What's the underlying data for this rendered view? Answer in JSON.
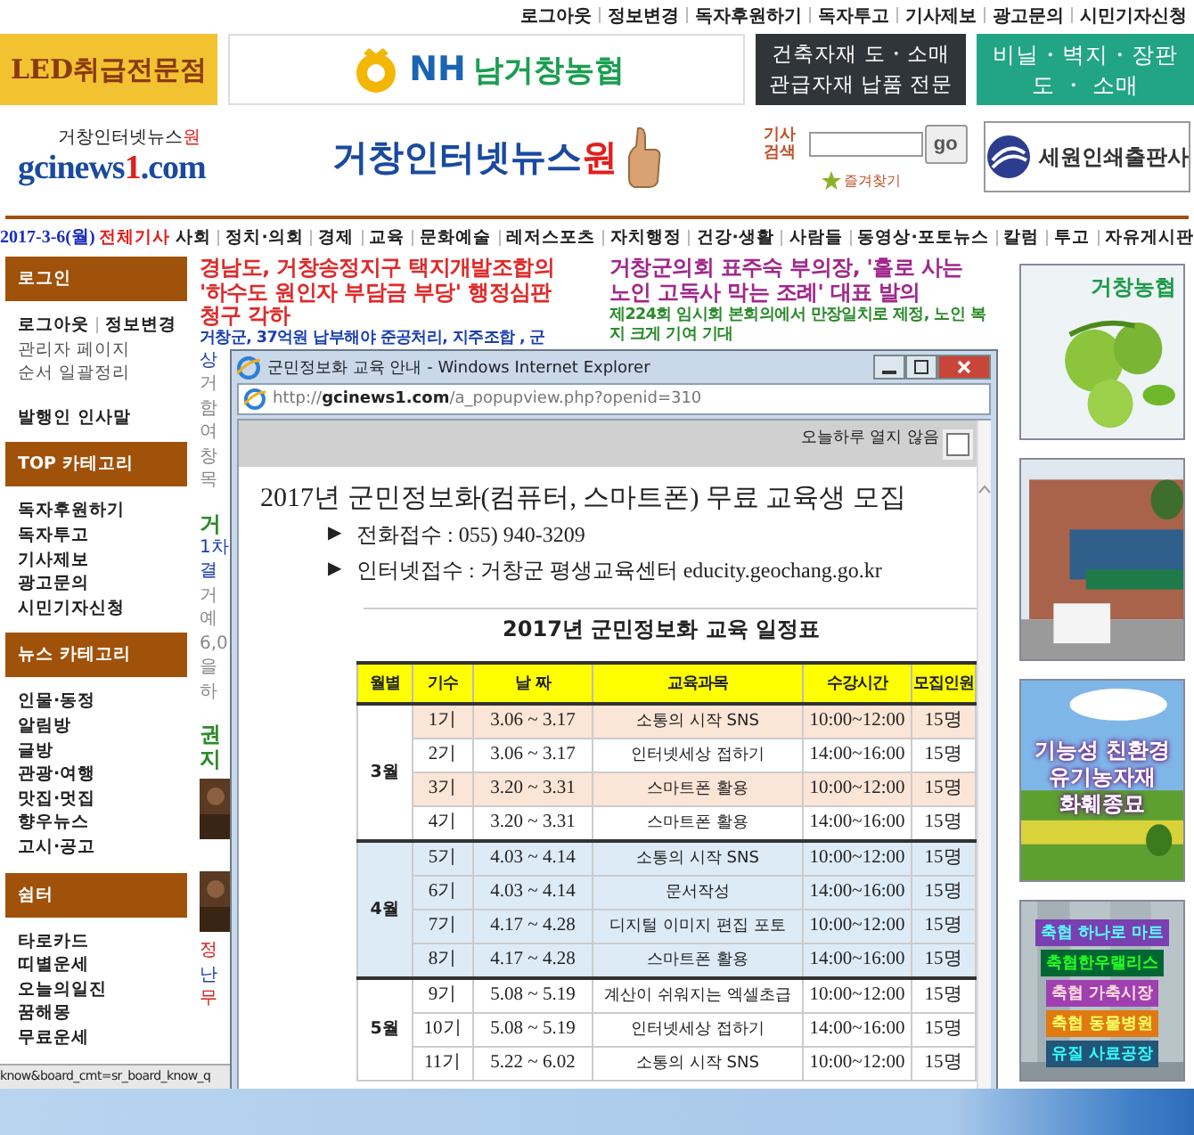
{
  "top_links": [
    "로그아웃",
    "정보변경",
    "독자후원하기",
    "독자투고",
    "기사제보",
    "광고문의",
    "시민기자신청"
  ],
  "header_ads": {
    "led": "LED취급전문점",
    "nh_prefix": "NH",
    "nh_name": "남거창농협",
    "building": [
      "건축자재 도・소매",
      "관급자재 납품 전문"
    ],
    "vinyl": [
      "비닐・벽지・장판",
      "도 ・ 소매"
    ]
  },
  "logo": {
    "sub": "거창인터넷뉴스",
    "sub_accent": "원",
    "main": "gcinews",
    "main_accent": "1",
    "main_end": ".com"
  },
  "site_title": {
    "text": "거창인터넷뉴스",
    "accent": "원"
  },
  "search": {
    "label": "기사 검색",
    "button": "go",
    "bookmark": "즐겨찾기"
  },
  "print_ad": "세원인쇄출판사",
  "nav": {
    "date": "2017-3-6(월)",
    "all": "전체기사",
    "items": [
      "사회",
      "정치·의회",
      "경제",
      "교육",
      "문화예술",
      "레저스포츠",
      "자치행정",
      "건강·생활",
      "사람들",
      "동영상·포토뉴스",
      "칼럼",
      "투고",
      "자유게시판"
    ]
  },
  "sidebar": [
    {
      "title": "로그인",
      "links": [
        "로그아웃",
        "정보변경"
      ],
      "items": [
        "관리자 페이지",
        "순서 일괄정리"
      ],
      "extra": "발행인 인사말"
    },
    {
      "title": "TOP 카테고리",
      "items": [
        "독자후원하기",
        "독자투고",
        "기사제보",
        "광고문의",
        "시민기자신청"
      ]
    },
    {
      "title": "뉴스 카테고리",
      "items": [
        "인물·동정",
        "알림방",
        "글방",
        "관광·여행",
        "맛집·멋집",
        "향우뉴스",
        "고시·공고"
      ]
    },
    {
      "title": "쉼터",
      "items": [
        "타로카드",
        "띠별운세",
        "오늘의일진",
        "꿈해몽",
        "무료운세"
      ]
    }
  ],
  "news": [
    {
      "headline": "경남도, 거창송정지구 택지개발조합의 '하수도 원인자 부담금 부당' 행정심판 청구 각하",
      "subtitle": "거창군, 37억원 납부해야 준공처리, 지주조합 , 군"
    },
    {
      "headline": "거창군의회 표주숙 부의장, '홀로 사는 노인 고독사 막는 조례' 대표 발의",
      "subtitle": "제224회 임시회 본회의에서 만장일치로 제정, 노인 복지 크게 기여 기대"
    }
  ],
  "fragments": [
    {
      "kind": "sub",
      "text": "상"
    },
    {
      "kind": "body",
      "text": "거"
    },
    {
      "kind": "body",
      "text": "함"
    },
    {
      "kind": "body",
      "text": "여"
    },
    {
      "kind": "body",
      "text": "창"
    },
    {
      "kind": "body",
      "text": "목"
    },
    {
      "kind": "gap"
    },
    {
      "kind": "green",
      "text": "거"
    },
    {
      "kind": "sub",
      "text": "1차"
    },
    {
      "kind": "sub",
      "text": "결"
    },
    {
      "kind": "body",
      "text": "거"
    },
    {
      "kind": "body",
      "text": "예"
    },
    {
      "kind": "body",
      "text": "6,0"
    },
    {
      "kind": "body",
      "text": "을"
    },
    {
      "kind": "body",
      "text": "하"
    },
    {
      "kind": "gap"
    },
    {
      "kind": "green",
      "text": "권"
    },
    {
      "kind": "green",
      "text": "지"
    },
    {
      "kind": "picture"
    },
    {
      "kind": "gap"
    },
    {
      "kind": "picture"
    },
    {
      "kind": "red",
      "text": "정"
    },
    {
      "kind": "sub",
      "text": "난"
    },
    {
      "kind": "red",
      "text": "무"
    }
  ],
  "right_ads": [
    {
      "kind": "orchard",
      "text": [
        "거창농협"
      ]
    },
    {
      "kind": "building"
    },
    {
      "kind": "field",
      "text": [
        "기능성 친환경",
        "유기농자재",
        "화훼종묘"
      ]
    },
    {
      "kind": "labels",
      "text": [
        "축협 하나로 마트",
        "축협한우랠리스",
        "축협 가축시장",
        "축협 동물병원",
        "유질 사료공장"
      ]
    }
  ],
  "popup": {
    "title": "군민정보화 교육 안내 - Windows Internet Explorer",
    "address": "http://**gcinews1.com**/a_popupview.php?openid=310",
    "dismiss": {
      "label": "오늘하루 열지 않음",
      "checked": false
    },
    "heading": "2017년 군민정보화(컴퓨터, 스마트폰) 무료 교육생 모집",
    "bullet": "▶",
    "lines": [
      "전화접수 : 055) 940-3209",
      "인터넷접수 : 거창군 평생교육센터 educity.geochang.go.kr"
    ],
    "table_title": "2017년 군민정보화 교육 일정표",
    "columns": [
      "월별",
      "기수",
      "날 짜",
      "교육과목",
      "수강시간",
      "모집인원"
    ],
    "groups": [
      {
        "month": "3월",
        "shaded": false,
        "rows": [
          {
            "term": "1기",
            "dates": "3.06 ~ 3.17",
            "course": "소통의 시작 SNS",
            "time": "10:00~12:00",
            "seats": "15명",
            "highlighted": true
          },
          {
            "term": "2기",
            "dates": "3.06 ~ 3.17",
            "course": "인터넷세상 접하기",
            "time": "14:00~16:00",
            "seats": "15명",
            "highlighted": false
          },
          {
            "term": "3기",
            "dates": "3.20 ~ 3.31",
            "course": "스마트폰 활용",
            "time": "10:00~12:00",
            "seats": "15명",
            "highlighted": true
          },
          {
            "term": "4기",
            "dates": "3.20 ~ 3.31",
            "course": "스마트폰 활용",
            "time": "14:00~16:00",
            "seats": "15명",
            "highlighted": false
          }
        ]
      },
      {
        "month": "4월",
        "shaded": true,
        "rows": [
          {
            "term": "5기",
            "dates": "4.03 ~ 4.14",
            "course": "소통의 시작 SNS",
            "time": "10:00~12:00",
            "seats": "15명",
            "highlighted": false
          },
          {
            "term": "6기",
            "dates": "4.03 ~ 4.14",
            "course": "문서작성",
            "time": "14:00~16:00",
            "seats": "15명",
            "highlighted": false
          },
          {
            "term": "7기",
            "dates": "4.17 ~ 4.28",
            "course": "디지털 이미지 편집 포토",
            "time": "10:00~12:00",
            "seats": "15명",
            "highlighted": false
          },
          {
            "term": "8기",
            "dates": "4.17 ~ 4.28",
            "course": "스마트폰 활용",
            "time": "14:00~16:00",
            "seats": "15명",
            "highlighted": false
          }
        ]
      },
      {
        "month": "5월",
        "shaded": false,
        "rows": [
          {
            "term": "9기",
            "dates": "5.08 ~ 5.19",
            "course": "계산이 쉬워지는 엑셀초급",
            "time": "10:00~12:00",
            "seats": "15명",
            "highlighted": false
          },
          {
            "term": "10기",
            "dates": "5.08 ~ 5.19",
            "course": "인터넷세상 접하기",
            "time": "14:00~16:00",
            "seats": "15명",
            "highlighted": false
          },
          {
            "term": "11기",
            "dates": "5.22 ~ 6.02",
            "course": "소통의 시작 SNS",
            "time": "10:00~12:00",
            "seats": "15명",
            "highlighted": false
          }
        ]
      }
    ]
  },
  "status_bar": "know&board_cmt=sr_board_know_q"
}
